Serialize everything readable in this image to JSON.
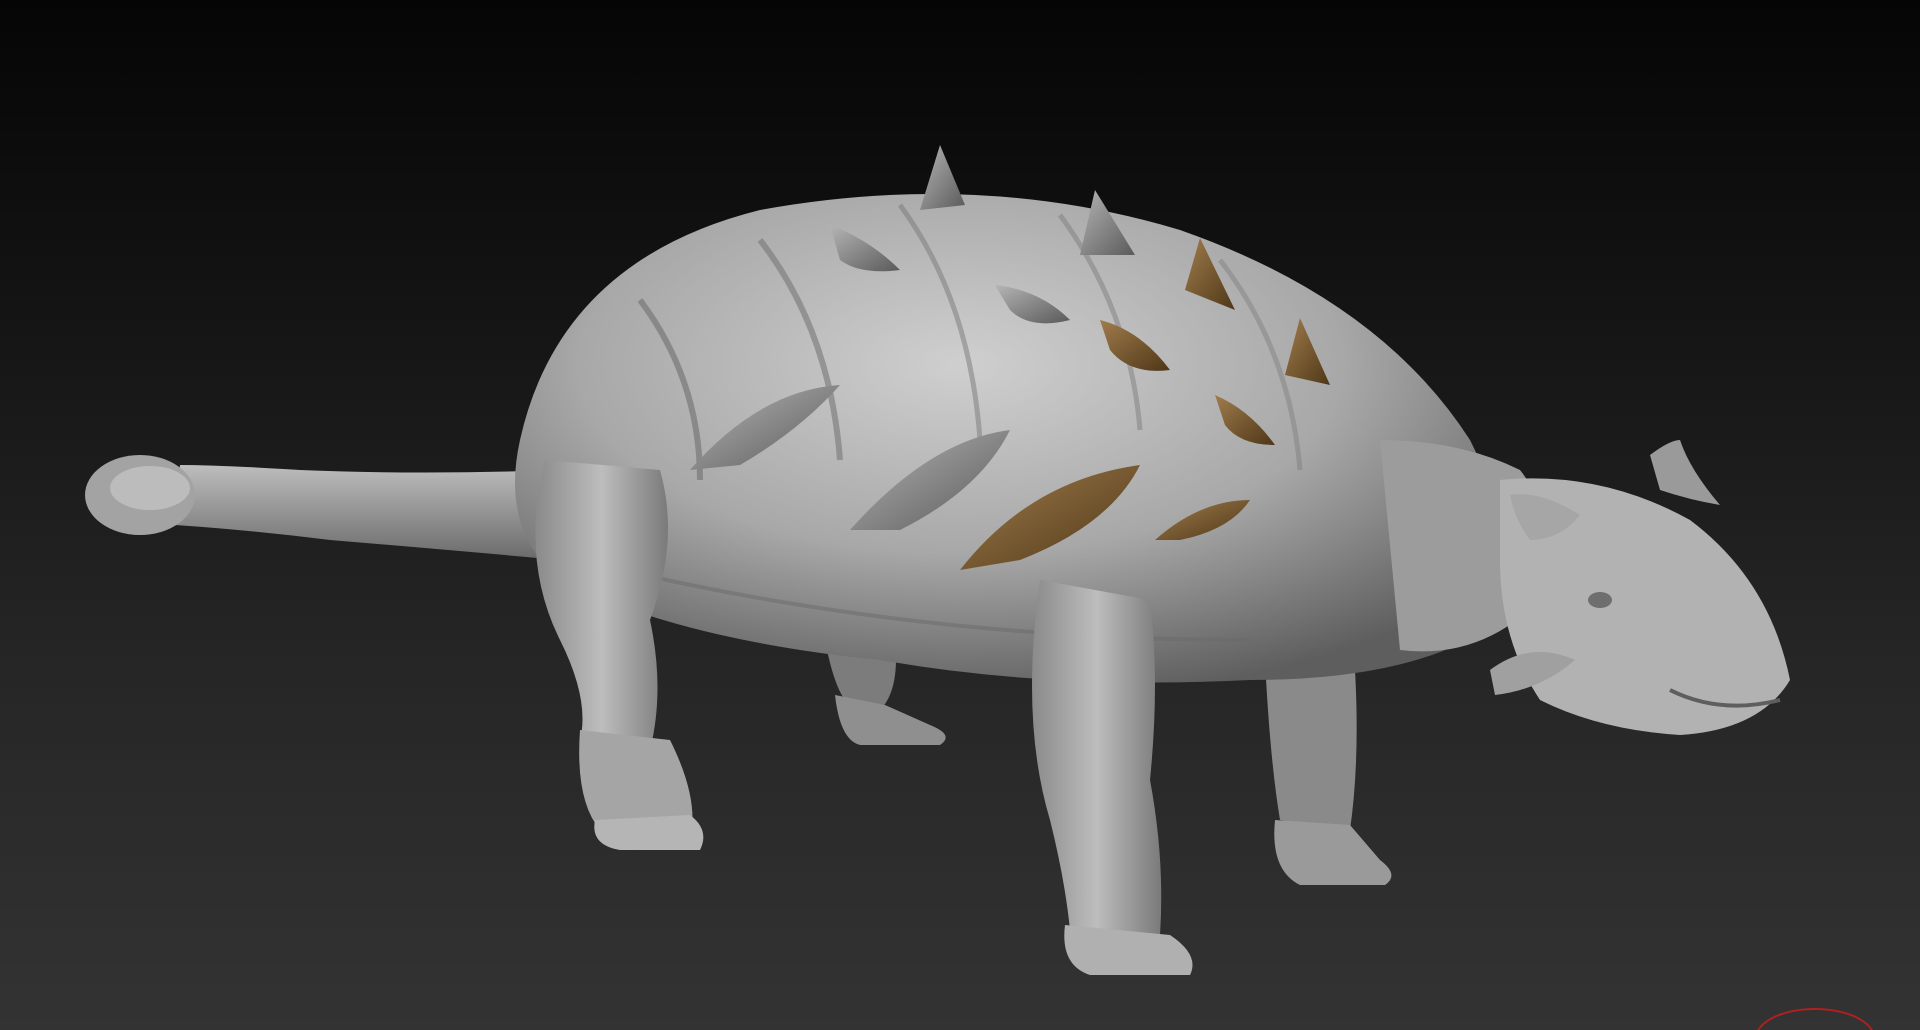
{
  "viewport": {
    "background_top": "#050505",
    "background_bottom": "#333333"
  },
  "model": {
    "name": "ankylosaur-sculpt",
    "base_material_color": "#a9a9a9",
    "spike_color_grey": "#8c8c8c",
    "spike_color_brown": "#7a5a32"
  },
  "gizmo": {
    "icon": "view-orientation-gizmo-icon",
    "color": "#b02020"
  }
}
